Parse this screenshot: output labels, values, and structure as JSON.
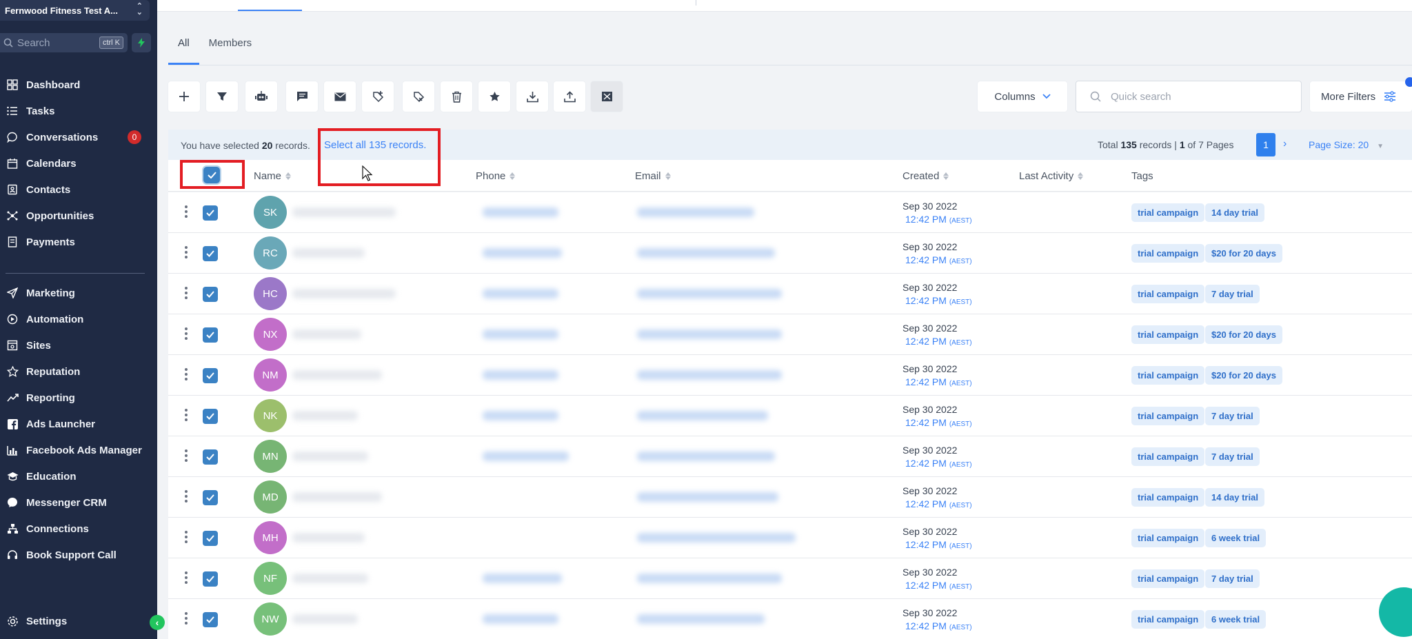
{
  "sidebar": {
    "account_name": "Fernwood Fitness Test A...",
    "search": {
      "placeholder": "Search",
      "shortcut": "ctrl K"
    },
    "items": [
      {
        "label": "Dashboard",
        "icon": "dashboard-icon"
      },
      {
        "label": "Tasks",
        "icon": "tasks-icon"
      },
      {
        "label": "Conversations",
        "icon": "chat-icon",
        "badge": "0"
      },
      {
        "label": "Calendars",
        "icon": "calendar-icon"
      },
      {
        "label": "Contacts",
        "icon": "contacts-icon"
      },
      {
        "label": "Opportunities",
        "icon": "opportunities-icon"
      },
      {
        "label": "Payments",
        "icon": "payments-icon"
      },
      {
        "label": "Marketing",
        "icon": "send-icon"
      },
      {
        "label": "Automation",
        "icon": "automation-icon"
      },
      {
        "label": "Sites",
        "icon": "sites-icon"
      },
      {
        "label": "Reputation",
        "icon": "star-icon"
      },
      {
        "label": "Reporting",
        "icon": "chart-icon"
      },
      {
        "label": "Ads Launcher",
        "icon": "facebook-icon"
      },
      {
        "label": "Facebook Ads Manager",
        "icon": "bar-chart-icon"
      },
      {
        "label": "Education",
        "icon": "graduation-icon"
      },
      {
        "label": "Messenger CRM",
        "icon": "messenger-icon"
      },
      {
        "label": "Connections",
        "icon": "connections-icon"
      },
      {
        "label": "Book Support Call",
        "icon": "headset-icon"
      }
    ],
    "settings_label": "Settings"
  },
  "tabs": [
    "All",
    "Members"
  ],
  "toolbar": {
    "buttons": [
      "add-icon",
      "filter-icon",
      "robot-icon",
      "sms-icon",
      "email-icon",
      "add-tag-icon",
      "remove-tag-icon",
      "trash-icon",
      "star-icon",
      "download-icon",
      "upload-icon",
      "merge-icon"
    ],
    "columns_label": "Columns",
    "search_placeholder": "Quick search",
    "more_filters_label": "More Filters"
  },
  "selection": {
    "prefix": "You have selected",
    "count": "20",
    "suffix": "records.",
    "select_all": "Select all 135 records."
  },
  "pagination": {
    "total_prefix": "Total",
    "total": "135",
    "records_label": "records |",
    "current": "1",
    "of_label": "of 7 Pages",
    "current_page": "1",
    "page_size": "Page Size: 20"
  },
  "columns": [
    "Name",
    "Phone",
    "Email",
    "Created",
    "Last Activity",
    "Tags"
  ],
  "rows": [
    {
      "initials": "SK",
      "color": "#5fa3ad",
      "created_date": "Sep 30 2022",
      "created_time": "12:42 PM",
      "tz": "(AEST)",
      "tags": [
        "trial campaign",
        "14 day trial"
      ]
    },
    {
      "initials": "RC",
      "color": "#6aa8b8",
      "created_date": "Sep 30 2022",
      "created_time": "12:42 PM",
      "tz": "(AEST)",
      "tags": [
        "trial campaign",
        "$20 for 20 days"
      ]
    },
    {
      "initials": "HC",
      "color": "#9b78c8",
      "created_date": "Sep 30 2022",
      "created_time": "12:42 PM",
      "tz": "(AEST)",
      "tags": [
        "trial campaign",
        "7 day trial"
      ]
    },
    {
      "initials": "NX",
      "color": "#c26ec9",
      "created_date": "Sep 30 2022",
      "created_time": "12:42 PM",
      "tz": "(AEST)",
      "tags": [
        "trial campaign",
        "$20 for 20 days"
      ]
    },
    {
      "initials": "NM",
      "color": "#c26ec9",
      "created_date": "Sep 30 2022",
      "created_time": "12:42 PM",
      "tz": "(AEST)",
      "tags": [
        "trial campaign",
        "$20 for 20 days"
      ]
    },
    {
      "initials": "NK",
      "color": "#9cbf6c",
      "created_date": "Sep 30 2022",
      "created_time": "12:42 PM",
      "tz": "(AEST)",
      "tags": [
        "trial campaign",
        "7 day trial"
      ]
    },
    {
      "initials": "MN",
      "color": "#77b574",
      "created_date": "Sep 30 2022",
      "created_time": "12:42 PM",
      "tz": "(AEST)",
      "tags": [
        "trial campaign",
        "7 day trial"
      ]
    },
    {
      "initials": "MD",
      "color": "#77b574",
      "created_date": "Sep 30 2022",
      "created_time": "12:42 PM",
      "tz": "(AEST)",
      "tags": [
        "trial campaign",
        "14 day trial"
      ]
    },
    {
      "initials": "MH",
      "color": "#c26ec9",
      "created_date": "Sep 30 2022",
      "created_time": "12:42 PM",
      "tz": "(AEST)",
      "tags": [
        "trial campaign",
        "6 week trial"
      ]
    },
    {
      "initials": "NF",
      "color": "#77c07a",
      "created_date": "Sep 30 2022",
      "created_time": "12:42 PM",
      "tz": "(AEST)",
      "tags": [
        "trial campaign",
        "7 day trial"
      ]
    },
    {
      "initials": "NW",
      "color": "#77c07a",
      "created_date": "Sep 30 2022",
      "created_time": "12:42 PM",
      "tz": "(AEST)",
      "tags": [
        "trial campaign",
        "6 week trial"
      ]
    }
  ],
  "colors": {
    "accent": "#3b82f6",
    "sidebar": "#1f2a44",
    "highlight": "#e31d23"
  }
}
